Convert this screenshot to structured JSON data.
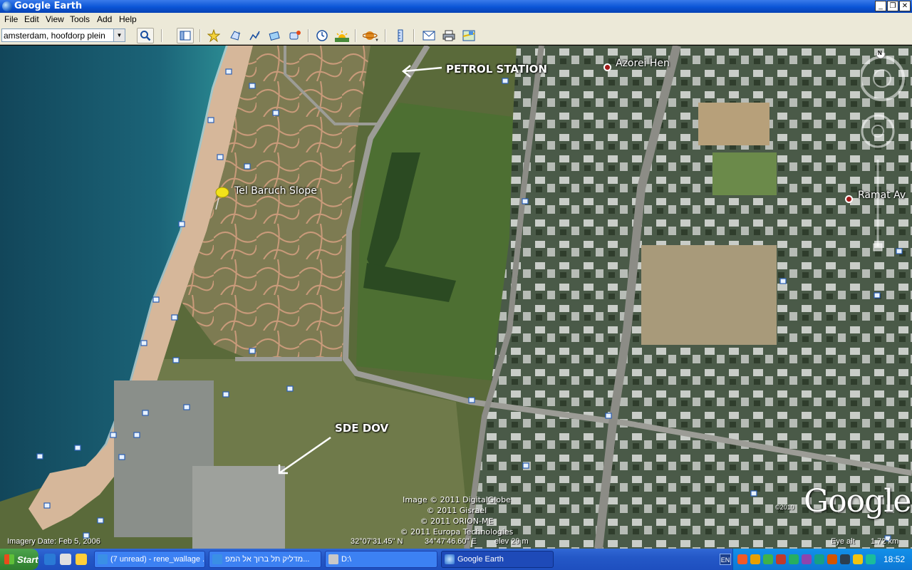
{
  "window": {
    "title": "Google Earth"
  },
  "menu": [
    "File",
    "Edit",
    "View",
    "Tools",
    "Add",
    "Help"
  ],
  "search": {
    "value": "amsterdam, hoofdorp plein"
  },
  "toolbar_icons": [
    "search-icon",
    "sidebar-toggle-icon",
    "placemark-icon",
    "polygon-icon",
    "path-icon",
    "image-overlay-icon",
    "tour-icon",
    "historical-imagery-icon",
    "sunlight-icon",
    "planets-icon",
    "ruler-icon",
    "email-icon",
    "print-icon",
    "maps-icon"
  ],
  "map": {
    "annotations": {
      "petrol_station": "PETROL STATION",
      "sde_dov": "SDE DOV"
    },
    "places": {
      "azorei_hen": "Azorei Hen",
      "ramat_av": "Ramat Av",
      "tel_baruch": "Tel Baruch Slope"
    },
    "credits": [
      "Image © 2011 DigitalGlobe",
      "© 2011 Gisrael",
      "© 2011 ORION-ME",
      "© 2011 Europa Technologies"
    ],
    "google_logo": "Google",
    "copyright_year": "©2010",
    "compass_letter": "N"
  },
  "status": {
    "imagery_date": "Imagery Date: Feb  5, 2006",
    "lat": "32°07'31.45\" N",
    "lon": "34°47'46.60\" E",
    "elev": "elev   29 m",
    "eye_alt_label": "Eye alt",
    "eye_alt_value": "1.72 km"
  },
  "taskbar": {
    "start_label": "Start",
    "tasks": [
      "(7 unread) - rene_wallage ...",
      "מדליק תל ברוך אל המפ...",
      "D:\\",
      "Google Earth"
    ],
    "lang": "EN",
    "clock": "18:52"
  }
}
